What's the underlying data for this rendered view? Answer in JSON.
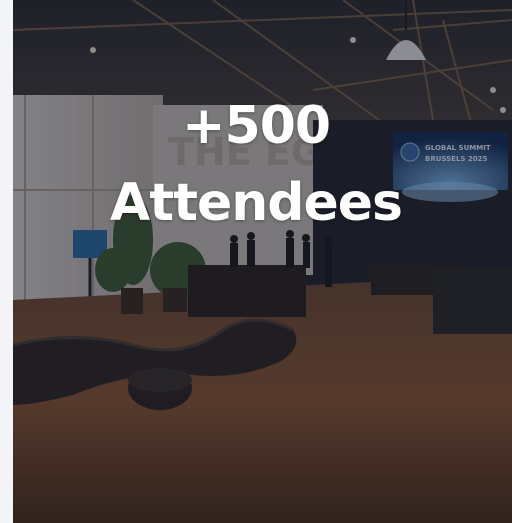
{
  "stat": {
    "number": "+500",
    "label": "Attendees"
  },
  "photo": {
    "screen_title": "GLOBAL SUMMIT",
    "screen_subtitle": "BRUSSELS 2025",
    "venue_wall_text": "THE EGG"
  },
  "colors": {
    "overlay": "#0e1422",
    "text": "#ffffff",
    "floor": "#7a4a2c",
    "wall": "#cfc9c4"
  }
}
